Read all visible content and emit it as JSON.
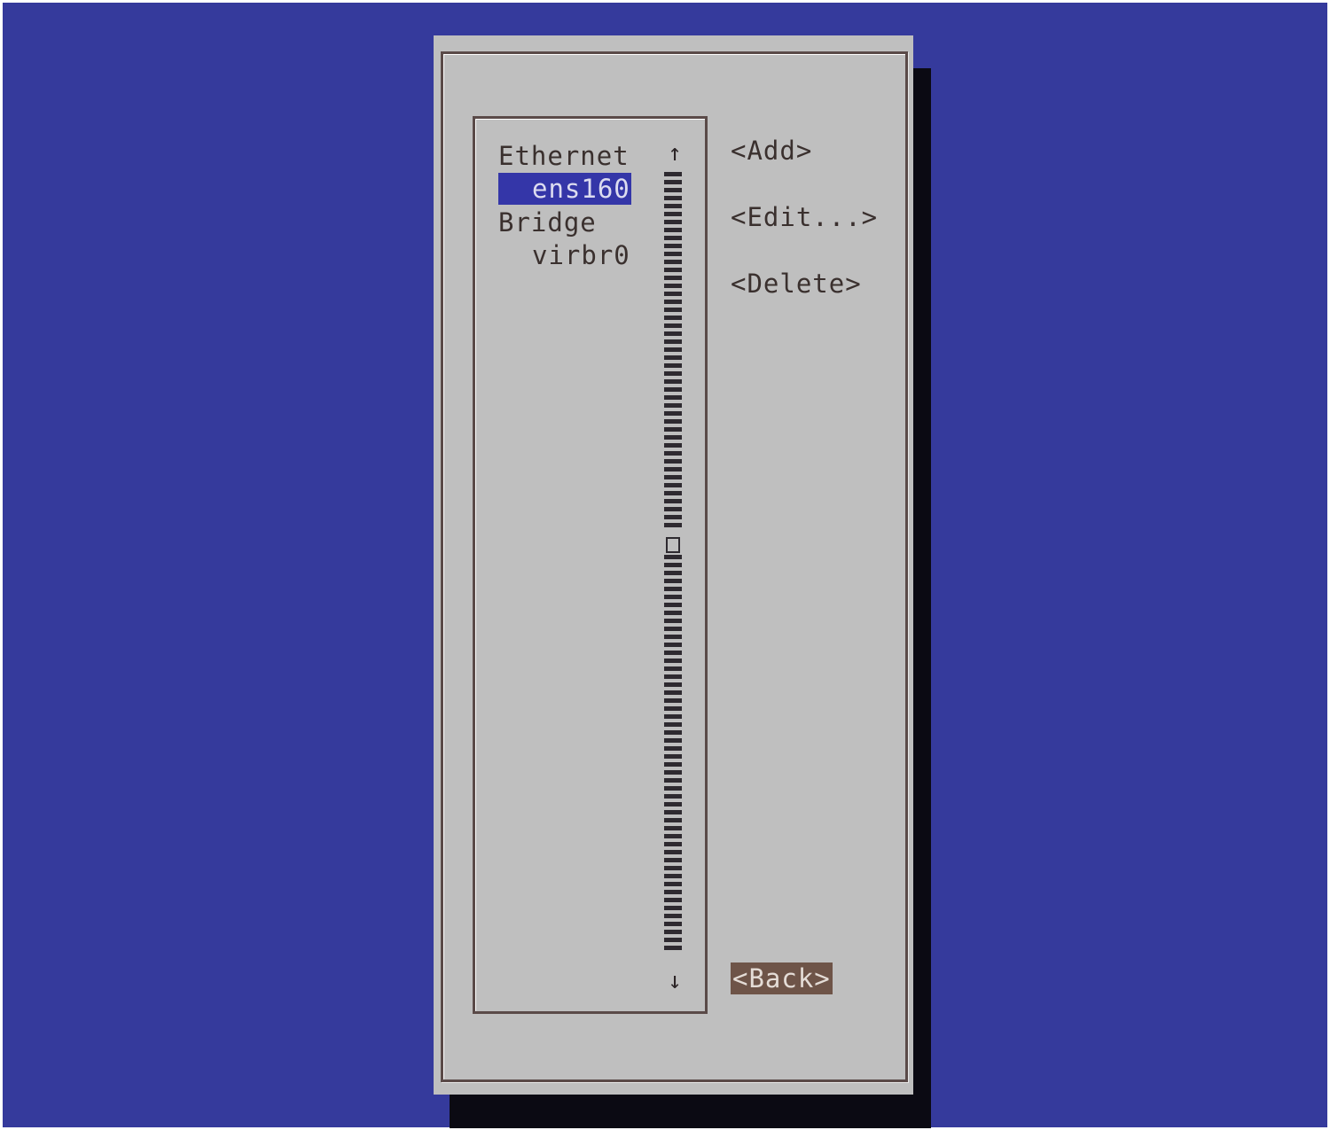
{
  "list": {
    "items": [
      {
        "label": "Ethernet",
        "indent": false,
        "selected": false
      },
      {
        "label": "ens160",
        "indent": true,
        "selected": true
      },
      {
        "label": "Bridge",
        "indent": false,
        "selected": false
      },
      {
        "label": "virbr0",
        "indent": true,
        "selected": false
      }
    ],
    "scroll_up": "↑",
    "scroll_down": "↓"
  },
  "buttons": {
    "add": "<Add>",
    "edit": "<Edit...>",
    "delete": "<Delete>",
    "back": "<Back>"
  },
  "colors": {
    "background": "#353a9c",
    "dialog": "#bfbfbf",
    "selection": "#3436a8",
    "focused_button": "#6e5448"
  }
}
